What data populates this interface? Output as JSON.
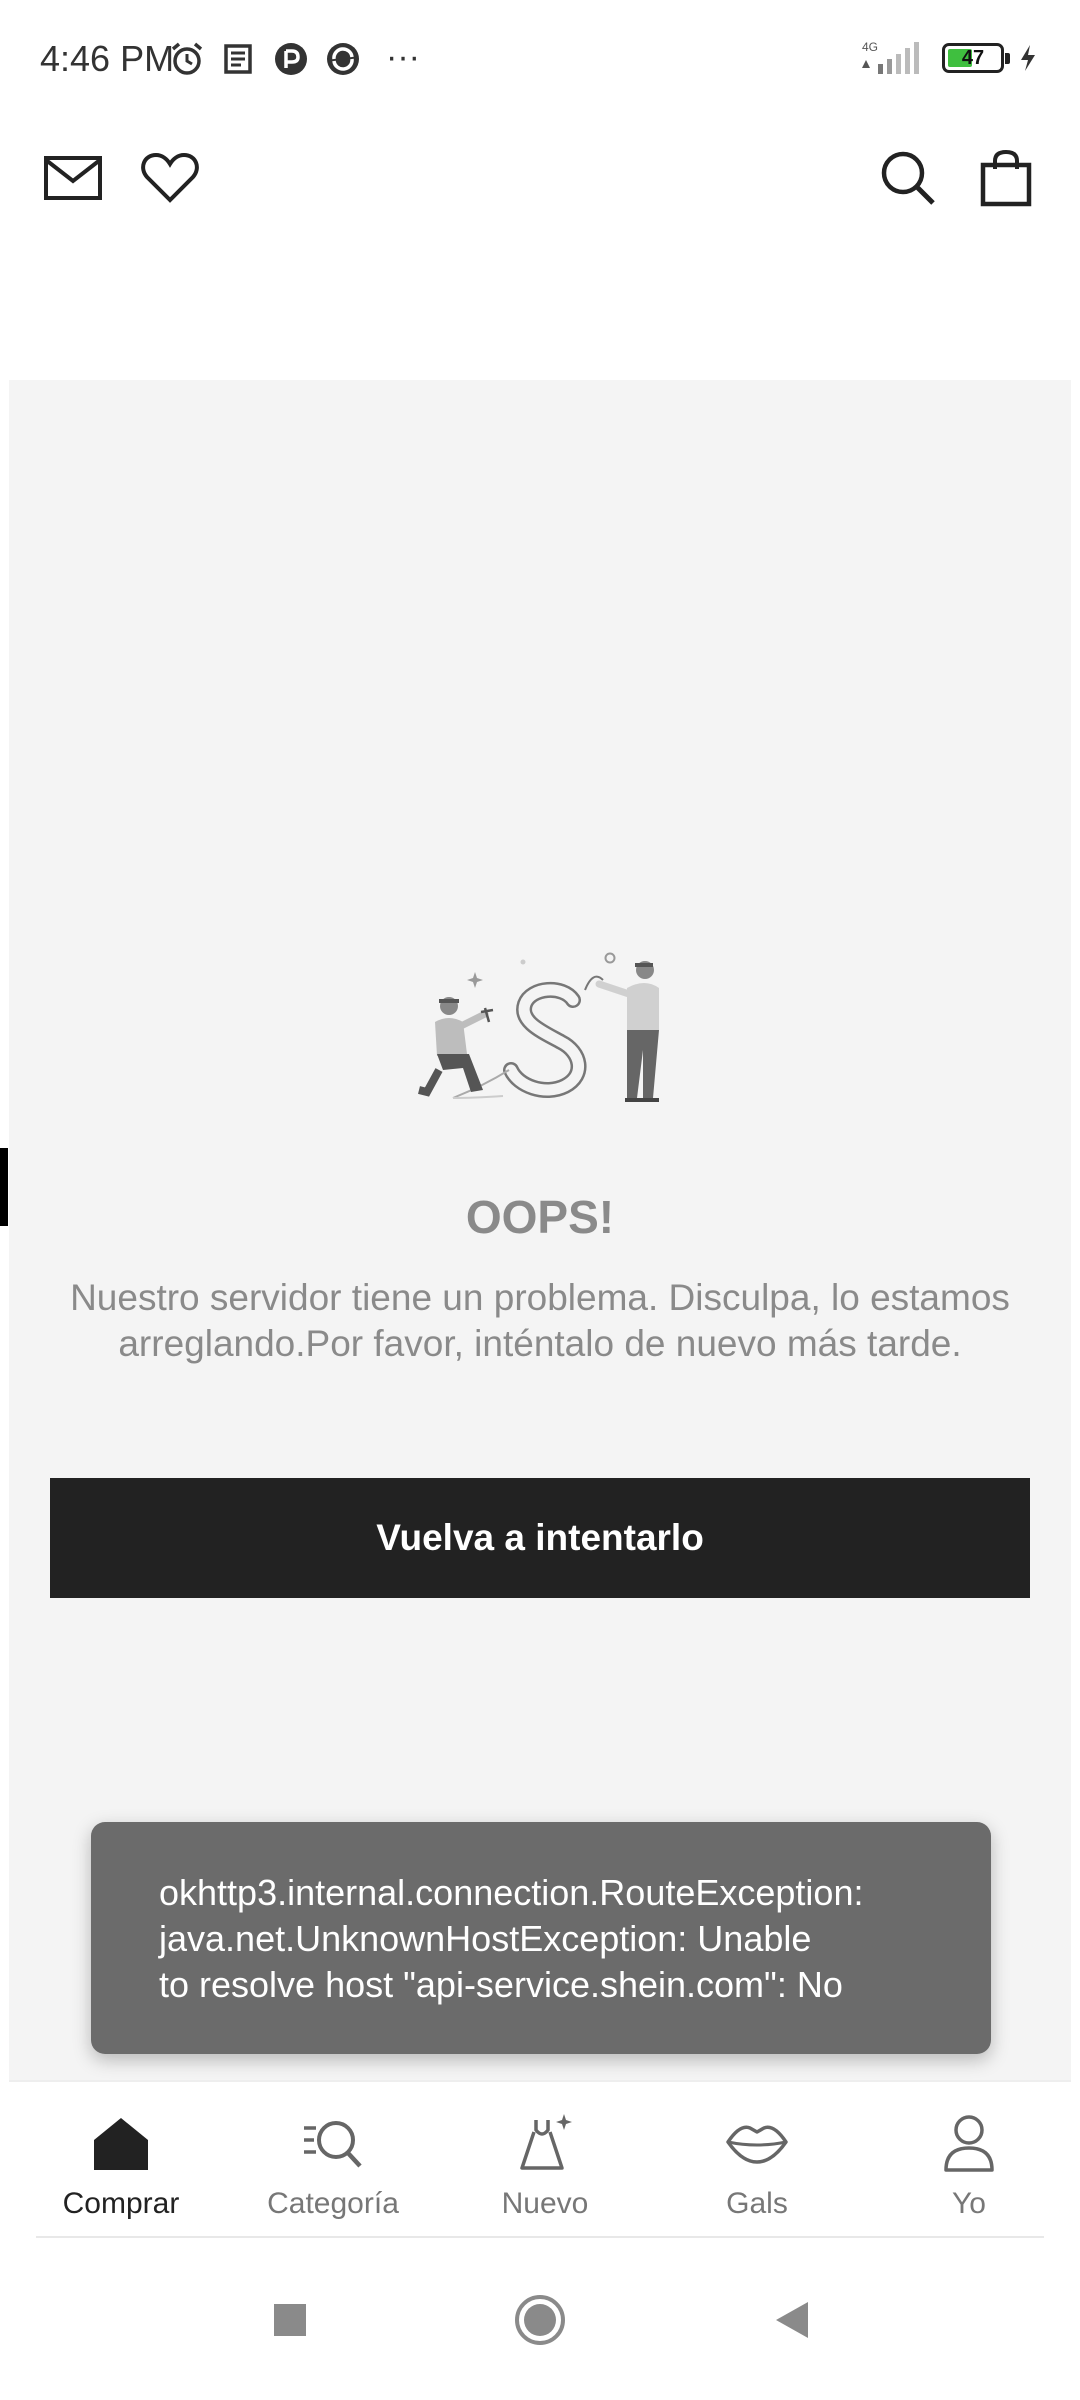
{
  "status_bar": {
    "time": "4:46 PM",
    "network": "4G",
    "battery_level": "47",
    "battery_fraction": 0.47,
    "icons": [
      "alarm-icon",
      "news-icon",
      "app-r-icon",
      "app-spin-icon",
      "more-dots-icon",
      "signal-icon",
      "charging-icon"
    ],
    "more": "···"
  },
  "top_bar": {
    "icons": [
      "mail-icon",
      "heart-icon",
      "search-icon",
      "shopping-bag-icon"
    ]
  },
  "error": {
    "title": "OOPS!",
    "message": "Nuestro servidor tiene un problema. Disculpa, lo estamos arreglando.Por favor, inténtalo de nuevo más tarde.",
    "retry_label": "Vuelva a intentarlo"
  },
  "toast": {
    "lines": [
      "okhttp3.internal.connection.RouteException:",
      "java.net.UnknownHostException: Unable",
      "to resolve host \"api-service.shein.com\": No"
    ]
  },
  "bottom_nav": {
    "items": [
      {
        "label": "Comprar",
        "icon": "home-icon",
        "active": true
      },
      {
        "label": "Categoría",
        "icon": "category-search-icon",
        "active": false
      },
      {
        "label": "Nuevo",
        "icon": "dress-sparkle-icon",
        "active": false
      },
      {
        "label": "Gals",
        "icon": "lips-icon",
        "active": false
      },
      {
        "label": "Yo",
        "icon": "person-icon",
        "active": false
      }
    ]
  },
  "system_nav": {
    "icons": [
      "recents-square-icon",
      "home-circle-icon",
      "back-triangle-icon"
    ]
  },
  "colors": {
    "background": "#f4f4f4",
    "button": "#222222",
    "muted_text": "#8a8a8a",
    "toast": "#6b6b6b",
    "battery_fill": "#3fbf3f"
  }
}
